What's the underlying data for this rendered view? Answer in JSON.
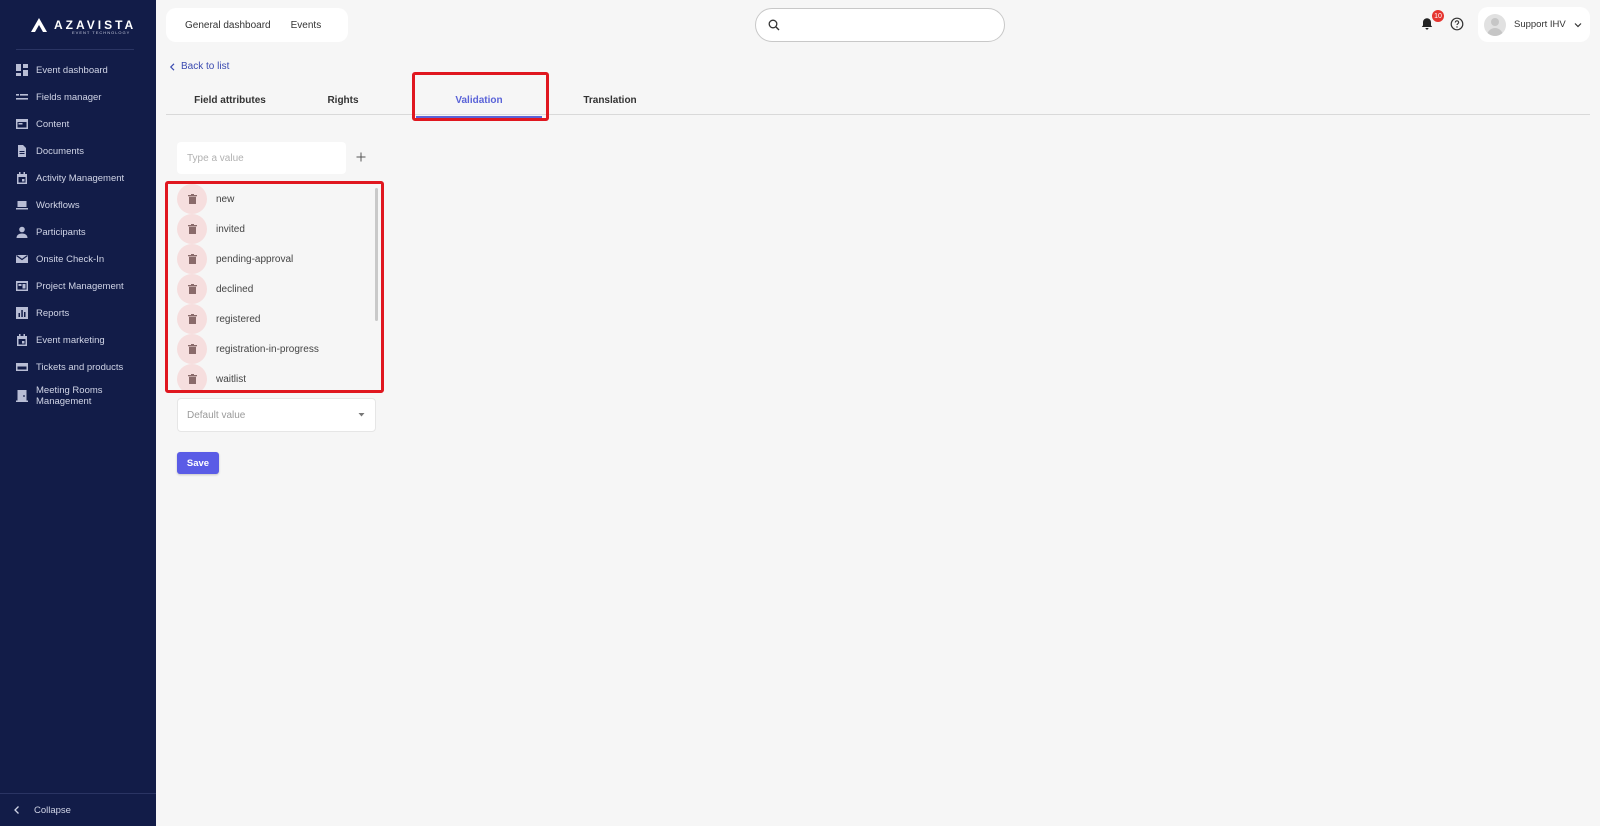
{
  "brand": {
    "name": "AZAVISTA",
    "tagline": "EVENT TECHNOLOGY"
  },
  "sidebar": {
    "items": [
      {
        "label": "Event dashboard",
        "icon": "dashboard-icon"
      },
      {
        "label": "Fields manager",
        "icon": "fields-icon"
      },
      {
        "label": "Content",
        "icon": "content-icon"
      },
      {
        "label": "Documents",
        "icon": "document-icon"
      },
      {
        "label": "Activity Management",
        "icon": "calendar-icon"
      },
      {
        "label": "Workflows",
        "icon": "laptop-icon"
      },
      {
        "label": "Participants",
        "icon": "person-icon"
      },
      {
        "label": "Onsite Check-In",
        "icon": "mail-icon"
      },
      {
        "label": "Project Management",
        "icon": "board-icon"
      },
      {
        "label": "Reports",
        "icon": "chart-icon"
      },
      {
        "label": "Event marketing",
        "icon": "calendar-icon"
      },
      {
        "label": "Tickets and products",
        "icon": "card-icon"
      },
      {
        "label": "Meeting Rooms Management",
        "icon": "room-icon"
      }
    ],
    "collapse_label": "Collapse"
  },
  "topbar": {
    "links": [
      "General dashboard",
      "Events"
    ],
    "search_placeholder": "",
    "notification_count": "10",
    "user_name": "Support IHV"
  },
  "main": {
    "back_label": "Back to list",
    "tabs": [
      {
        "label": "Field attributes",
        "active": false
      },
      {
        "label": "Rights",
        "active": false
      },
      {
        "label": "Validation",
        "active": true
      },
      {
        "label": "Translation",
        "active": false
      }
    ],
    "value_input_placeholder": "Type a value",
    "values": [
      "new",
      "invited",
      "pending-approval",
      "declined",
      "registered",
      "registration-in-progress",
      "waitlist"
    ],
    "default_value_placeholder": "Default value",
    "save_label": "Save"
  },
  "colors": {
    "sidebar": "#121c48",
    "accent": "#5a63d8",
    "highlight": "#e0171f",
    "button": "#5a5ce6"
  }
}
